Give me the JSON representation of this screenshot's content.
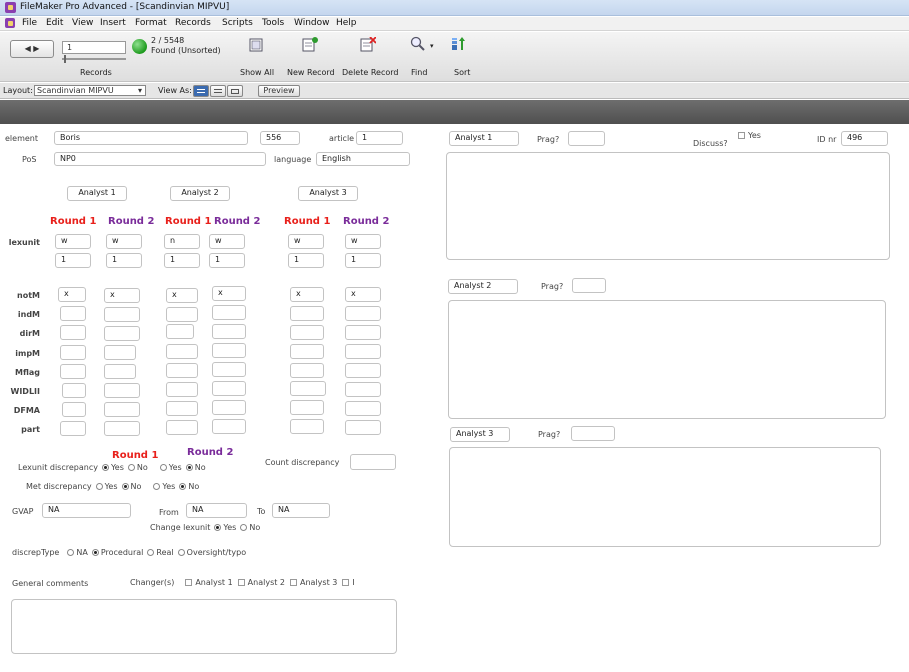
{
  "window": {
    "title": "FileMaker Pro Advanced - [Scandinvian MIPVU]"
  },
  "menu": [
    "File",
    "Edit",
    "View",
    "Insert",
    "Format",
    "Records",
    "Scripts",
    "Tools",
    "Window",
    "Help"
  ],
  "toolbar": {
    "record_number": "1",
    "records_label": "Records",
    "found_count": "2 / 5548",
    "found_status": "Found (Unsorted)",
    "show_all": "Show All",
    "new_record": "New Record",
    "delete_record": "Delete Record",
    "find": "Find",
    "sort": "Sort"
  },
  "layoutbar": {
    "layout_label": "Layout:",
    "layout_value": "Scandinvian MIPVU",
    "view_as_label": "View As:",
    "preview": "Preview"
  },
  "form": {
    "element_label": "element",
    "element_value": "Boris",
    "count_value": "556",
    "article_label": "article",
    "article_value": "1",
    "pos_label": "PoS",
    "pos_value": "NP0",
    "language_label": "language",
    "language_value": "English",
    "analyst_1": "Analyst 1",
    "analyst_2": "Analyst 2",
    "analyst_3": "Analyst 3",
    "round_1": "Round 1",
    "round_2": "Round 2",
    "lexunit_label": "lexunit",
    "lexunit_row1": [
      "w",
      "w",
      "n",
      "w",
      "w",
      "w"
    ],
    "lexunit_row2": [
      "1",
      "1",
      "1",
      "1",
      "1",
      "1"
    ],
    "notm_row": [
      "x",
      "x",
      "x",
      "x",
      "x",
      "x"
    ],
    "row_labels": [
      "notM",
      "indM",
      "dirM",
      "impM",
      "Mflag",
      "WIDLII",
      "DFMA",
      "part"
    ],
    "lexunit_disc_label": "Lexunit discrepancy",
    "met_disc_label": "Met discrepancy",
    "yes": "Yes",
    "no": "No",
    "count_disc_label": "Count discrepancy",
    "gvap_label": "GVAP",
    "gvap_value": "NA",
    "from_label": "From",
    "from_value": "NA",
    "to_label": "To",
    "to_value": "NA",
    "change_lexunit_label": "Change lexunit",
    "discrep_type_label": "discrepType",
    "discrep_options": [
      "NA",
      "Procedural",
      "Real",
      "Oversight/typo"
    ],
    "general_comments_label": "General comments",
    "changers_label": "Changer(s)",
    "changer_options": [
      "Analyst 1",
      "Analyst 2",
      "Analyst 3",
      "I"
    ]
  },
  "right": {
    "analyst_1": "Analyst 1",
    "analyst_2": "Analyst 2",
    "analyst_3": "Analyst 3",
    "prag_label": "Prag?",
    "discuss_label": "Discuss?",
    "discuss_yes": "Yes",
    "id_label": "ID nr",
    "id_value": "496"
  },
  "colors": {
    "round1": "#e8201b",
    "round2": "#7a2c9a"
  }
}
